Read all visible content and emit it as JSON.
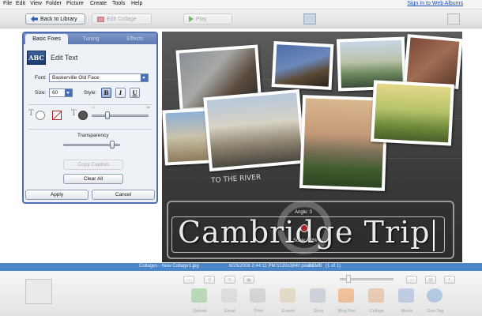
{
  "menubar": {
    "items": [
      "File",
      "Edit",
      "View",
      "Folder",
      "Picture",
      "Create",
      "Tools",
      "Help"
    ],
    "signin_link": "Sign In to Web Albums"
  },
  "toolbar": {
    "back_label": "Back to Library",
    "edit_collage_label": "Edit Collage",
    "play_label": "Play"
  },
  "panel": {
    "tabs": [
      "Basic Fixes",
      "Tuning",
      "Effects"
    ],
    "active_tab": "Basic Fixes",
    "title": "Edit Text",
    "icon_text": "ABC",
    "font_label": "Font:",
    "font_value": "Baskerville Old Face",
    "size_label": "Size:",
    "size_value": "60",
    "style_label": "Style:",
    "style_buttons": [
      "B",
      "I",
      "U"
    ],
    "bold_active": true,
    "size_ticks": [
      "1",
      "10"
    ],
    "transparency_label": "Transparency",
    "transparency_level": 0.85,
    "copy_caption_label": "Copy Caption",
    "clear_all_label": "Clear All",
    "apply_label": "Apply",
    "cancel_label": "Cancel"
  },
  "canvas": {
    "title_text": "Cambridge Trip",
    "graffiti_text": "TO THE RIVER",
    "angle_label": "Angle: 0",
    "scale_label": "Scale: 99%"
  },
  "statusbar": {
    "file": "Collages - New Collage1.jpg",
    "datetime": "6/25/2008 2:44:11 PM",
    "dimensions": "5120x3840 pixels",
    "size": "3.5MB",
    "position": "(1 of 1)"
  },
  "bottombar": {
    "share_items": [
      "Upload",
      "Email",
      "Print",
      "Export",
      "Shop",
      "BlogThis!",
      "Collage",
      "Movie",
      "Geo-Tag"
    ]
  }
}
